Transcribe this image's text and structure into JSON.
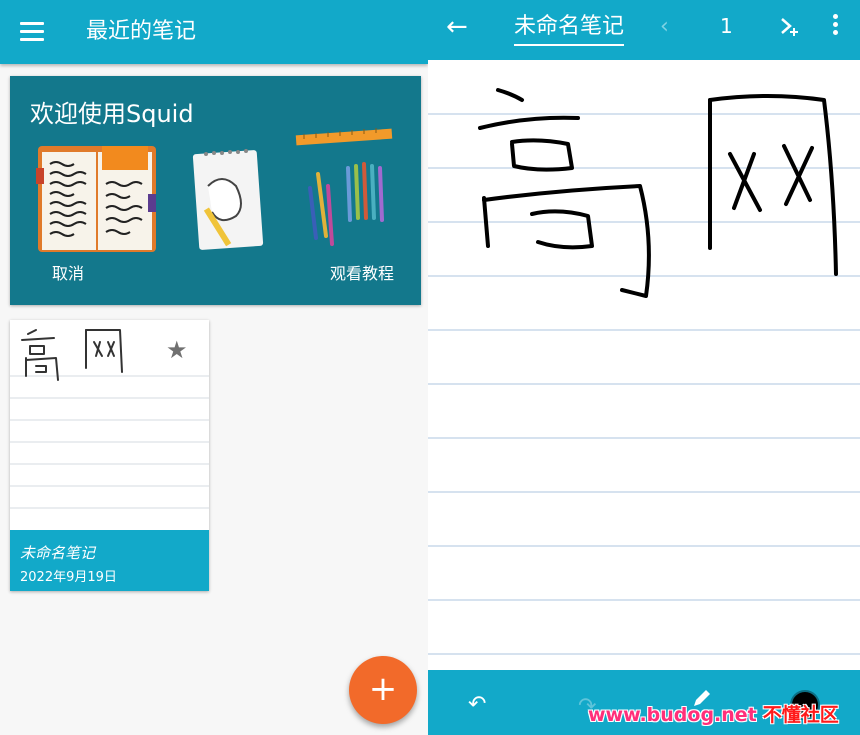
{
  "left_panel": {
    "app_bar": {
      "title": "最近的笔记",
      "menu_icon": "hamburger-menu-icon"
    },
    "welcome_card": {
      "title": "欢迎使用Squid",
      "cancel_label": "取消",
      "tutorial_label": "观看教程",
      "background_color": "#13788c"
    },
    "notes": [
      {
        "title": "未命名笔记",
        "date": "2022年9月19日",
        "starred": true,
        "preview_text": "高网"
      }
    ],
    "fab_label": "+",
    "accent_color": "#12a9c9",
    "fab_color": "#f26a2a"
  },
  "right_panel": {
    "app_bar": {
      "back_icon": "arrow-left-icon",
      "title": "未命名笔记",
      "prev_icon": "chevron-left-icon",
      "page_number": "1",
      "add_page_icon": "add-page-icon",
      "more_icon": "more-vert-icon"
    },
    "canvas": {
      "handwriting": "高网",
      "ruled": true
    },
    "toolbar": {
      "undo_icon": "undo-icon",
      "redo_icon": "redo-icon",
      "pen_icon": "pen-icon",
      "color_icon": "color-swatch-icon",
      "pen_color": "#000000"
    }
  },
  "watermark": {
    "site": "www.budog.net",
    "brand": "不懂社区"
  }
}
